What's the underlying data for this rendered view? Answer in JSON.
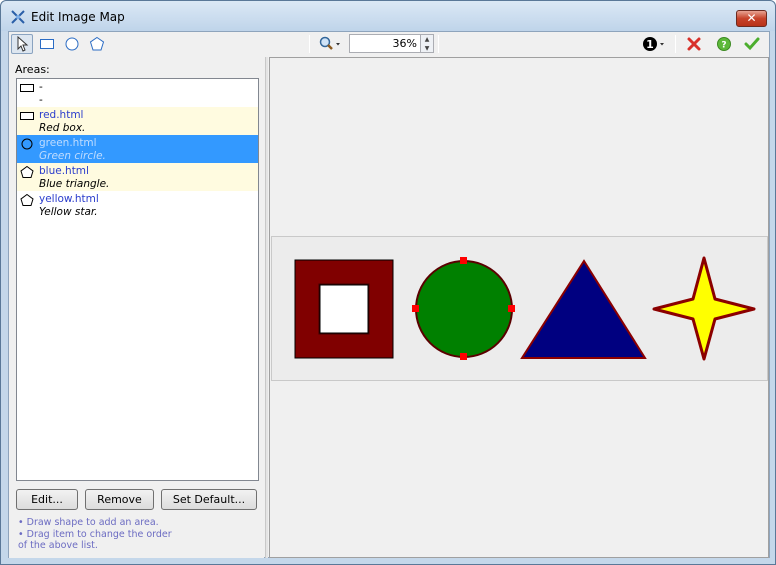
{
  "window": {
    "title": "Edit Image Map",
    "close_label": "✕"
  },
  "toolbar": {
    "zoom_value": "36%",
    "tools": [
      "pointer-tool",
      "rectangle-tool",
      "circle-tool",
      "polygon-tool"
    ]
  },
  "areas": {
    "label": "Areas:",
    "items": [
      {
        "shape": "rect",
        "href": "-",
        "desc": "-"
      },
      {
        "shape": "rect",
        "href": "red.html",
        "desc": "Red box."
      },
      {
        "shape": "circle",
        "href": "green.html",
        "desc": "Green circle."
      },
      {
        "shape": "poly",
        "href": "blue.html",
        "desc": "Blue triangle."
      },
      {
        "shape": "poly",
        "href": "yellow.html",
        "desc": "Yellow star."
      }
    ]
  },
  "buttons": {
    "edit": "Edit...",
    "remove": "Remove",
    "set_default": "Set Default..."
  },
  "hints": {
    "line1": "• Draw shape to add an area.",
    "line2": "• Drag item to change the order",
    "line3": "of the above list."
  },
  "colors": {
    "red_box": "#800000",
    "green_circle": "#008000",
    "blue_triangle": "#000080",
    "yellow_star": "#ffff00",
    "selection": "#3399ff",
    "handle": "#ff0000"
  }
}
